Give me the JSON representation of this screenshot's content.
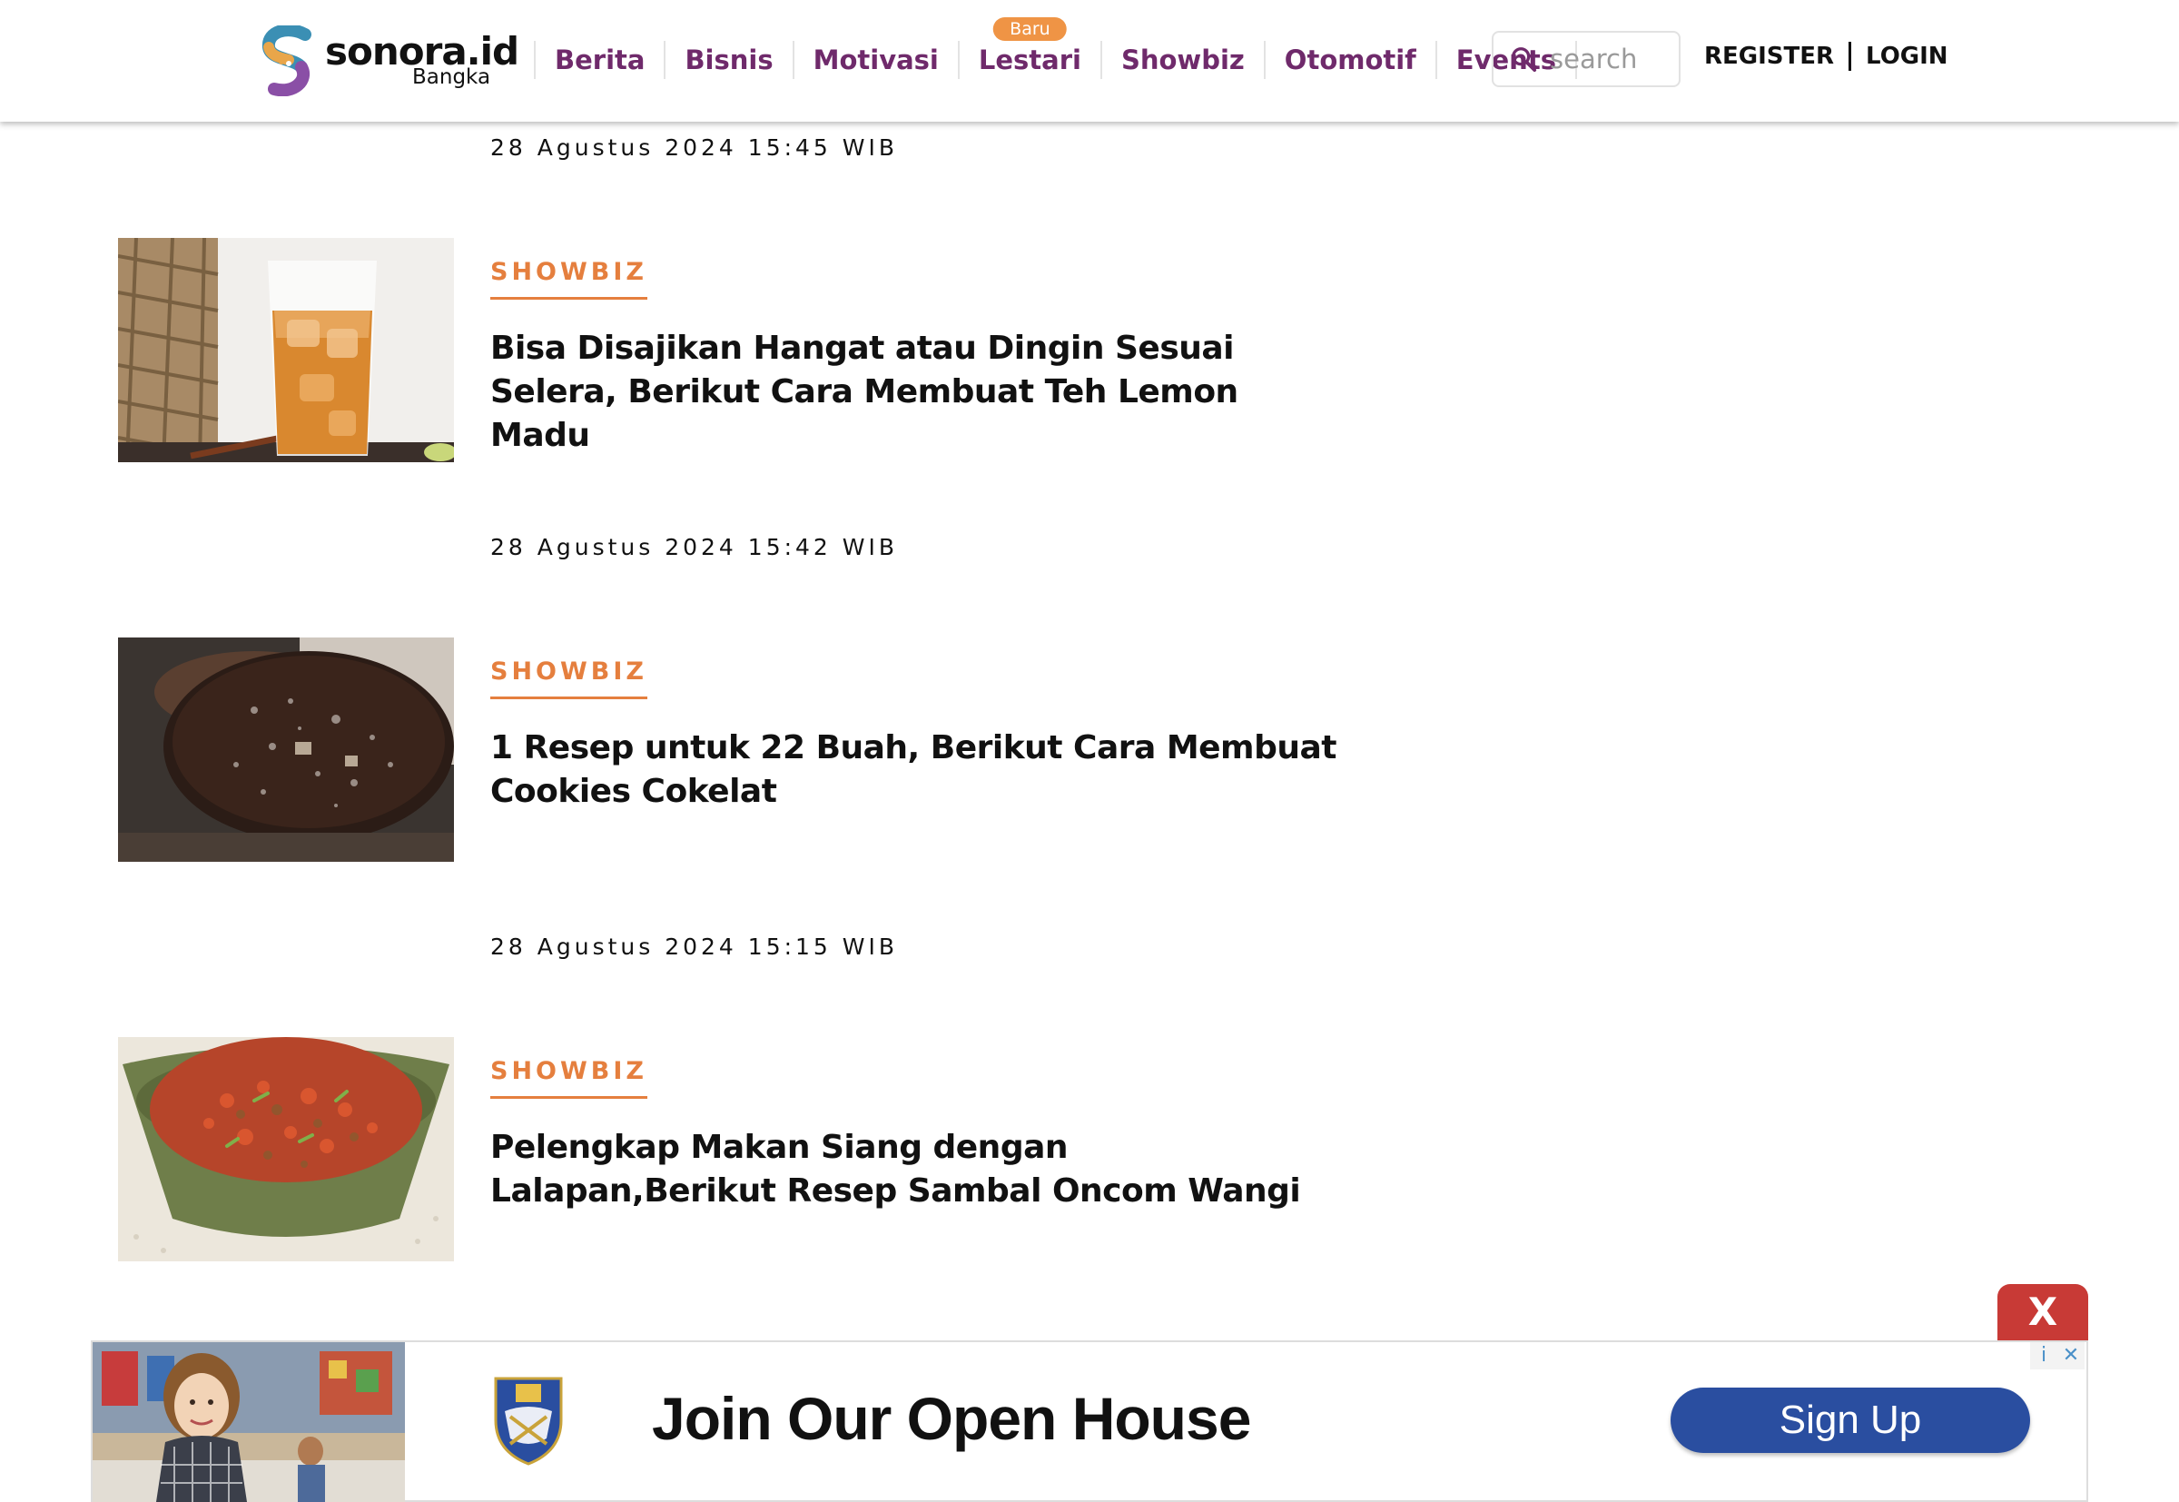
{
  "header": {
    "logo_name": "sonora.id",
    "logo_sub": "Bangka",
    "nav": [
      {
        "label": "Berita"
      },
      {
        "label": "Bisnis"
      },
      {
        "label": "Motivasi"
      },
      {
        "label": "Lestari",
        "badge": "Baru"
      },
      {
        "label": "Showbiz"
      },
      {
        "label": "Otomotif"
      },
      {
        "label": "Events"
      }
    ],
    "search_placeholder": "search",
    "register_label": "REGISTER",
    "login_label": "LOGIN",
    "nav_color": "#6f2a6b",
    "badge_color": "#ef9445"
  },
  "articles": [
    {
      "timestamp_above": "28 Agustus 2024 15:45 WIB",
      "category": "SHOWBIZ",
      "title": "Bisa Disajikan Hangat atau Dingin Sesuai Selera, Berikut Cara Membuat Teh Lemon Madu",
      "image": "iced-tea-glass"
    },
    {
      "timestamp_above": "28 Agustus 2024 15:42 WIB",
      "category": "SHOWBIZ",
      "title": "1 Resep untuk 22 Buah, Berikut Cara Membuat Cookies Cokelat",
      "image": "chocolate-cookie"
    },
    {
      "timestamp_above": "28 Agustus 2024 15:15 WIB",
      "category": "SHOWBIZ",
      "title": "Pelengkap Makan Siang dengan Lalapan,Berikut Resep Sambal Oncom Wangi",
      "image": "sambal-oncom-bowl"
    }
  ],
  "ad": {
    "close_label": "X",
    "headline": "Join Our Open House",
    "cta_label": "Sign Up",
    "info_icon": "i",
    "dismiss_icon": "✕",
    "cta_color": "#2a4ea0",
    "close_color": "#c83a36"
  },
  "accent_color": "#e57f3e"
}
